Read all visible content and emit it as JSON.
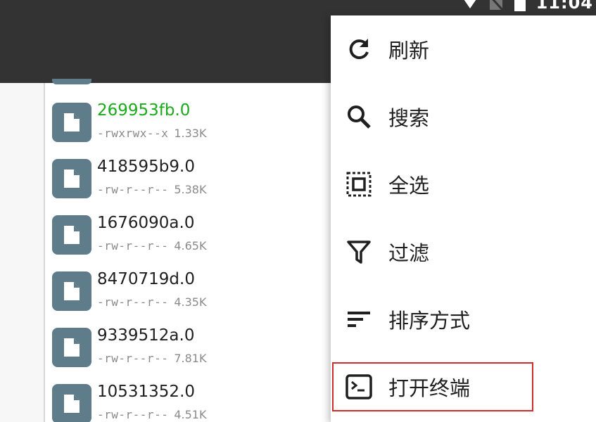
{
  "status_bar": {
    "time": "11:04",
    "icons": [
      "wifi-icon",
      "no-sim-icon",
      "battery-icon"
    ]
  },
  "files": [
    {
      "name": "269953fb.0",
      "permissions": "-rwxrwx--x",
      "size": "1.33K",
      "highlight": true,
      "icon": "file-icon"
    },
    {
      "name": "418595b9.0",
      "permissions": "-rw-r--r--",
      "size": "5.38K",
      "highlight": false,
      "icon": "file-icon"
    },
    {
      "name": "1676090a.0",
      "permissions": "-rw-r--r--",
      "size": "4.65K",
      "highlight": false,
      "icon": "file-icon"
    },
    {
      "name": "8470719d.0",
      "permissions": "-rw-r--r--",
      "size": "4.35K",
      "highlight": false,
      "icon": "file-icon"
    },
    {
      "name": "9339512a.0",
      "permissions": "-rw-r--r--",
      "size": "7.81K",
      "highlight": false,
      "icon": "file-icon"
    },
    {
      "name": "10531352.0",
      "permissions": "-rw-r--r--",
      "size": "4.51K",
      "highlight": false,
      "icon": "file-icon"
    }
  ],
  "menu": {
    "items": [
      {
        "label": "刷新",
        "icon": "refresh-icon"
      },
      {
        "label": "搜索",
        "icon": "search-icon"
      },
      {
        "label": "全选",
        "icon": "select-all-icon"
      },
      {
        "label": "过滤",
        "icon": "filter-icon"
      },
      {
        "label": "排序方式",
        "icon": "sort-icon"
      },
      {
        "label": "打开终端",
        "icon": "terminal-icon",
        "selected": true
      }
    ]
  },
  "colors": {
    "app_bar": "#333333",
    "file_icon_bg": "#5f7c8a",
    "highlight_name": "#1aaa1a",
    "selection_border": "#d12c2c"
  }
}
